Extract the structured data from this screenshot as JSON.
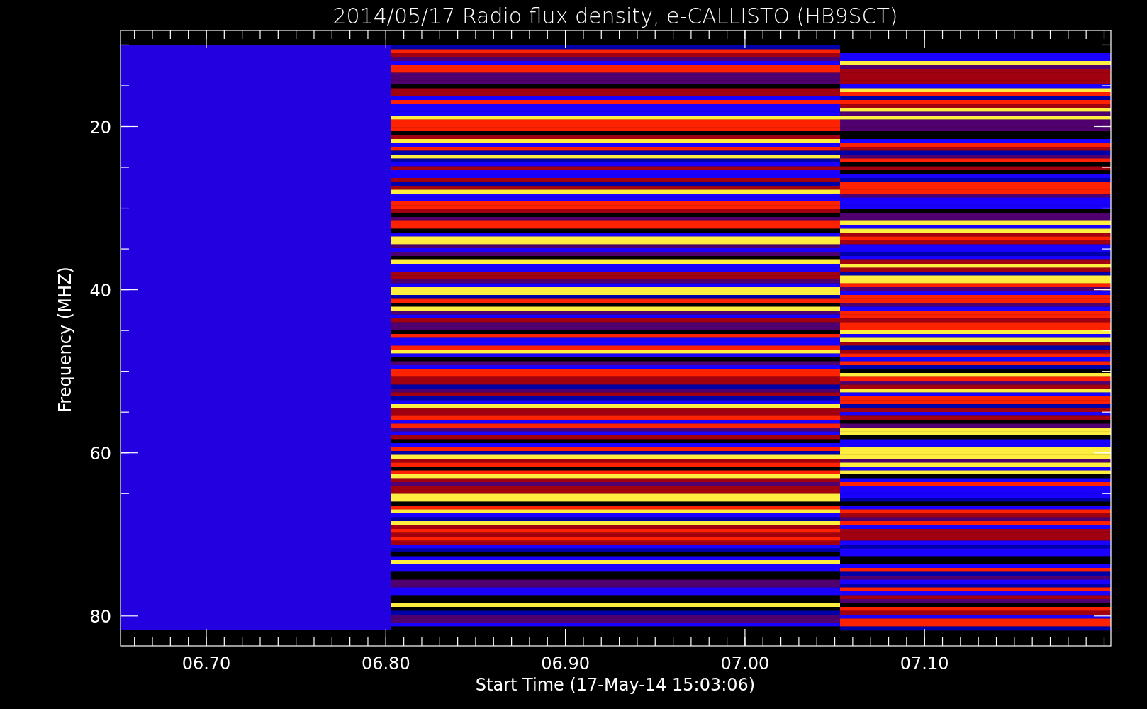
{
  "title": "2014/05/17  Radio flux density, e-CALLISTO (HB9SCT)",
  "x_axis": {
    "label": "Start Time (17-May-14 15:03:06)",
    "ticks": [
      "06.70",
      "06.80",
      "06.90",
      "07.00",
      "07.10"
    ]
  },
  "y_axis": {
    "label": "Frequency (MHZ)",
    "ticks": [
      "20",
      "40",
      "60",
      "80"
    ]
  }
}
